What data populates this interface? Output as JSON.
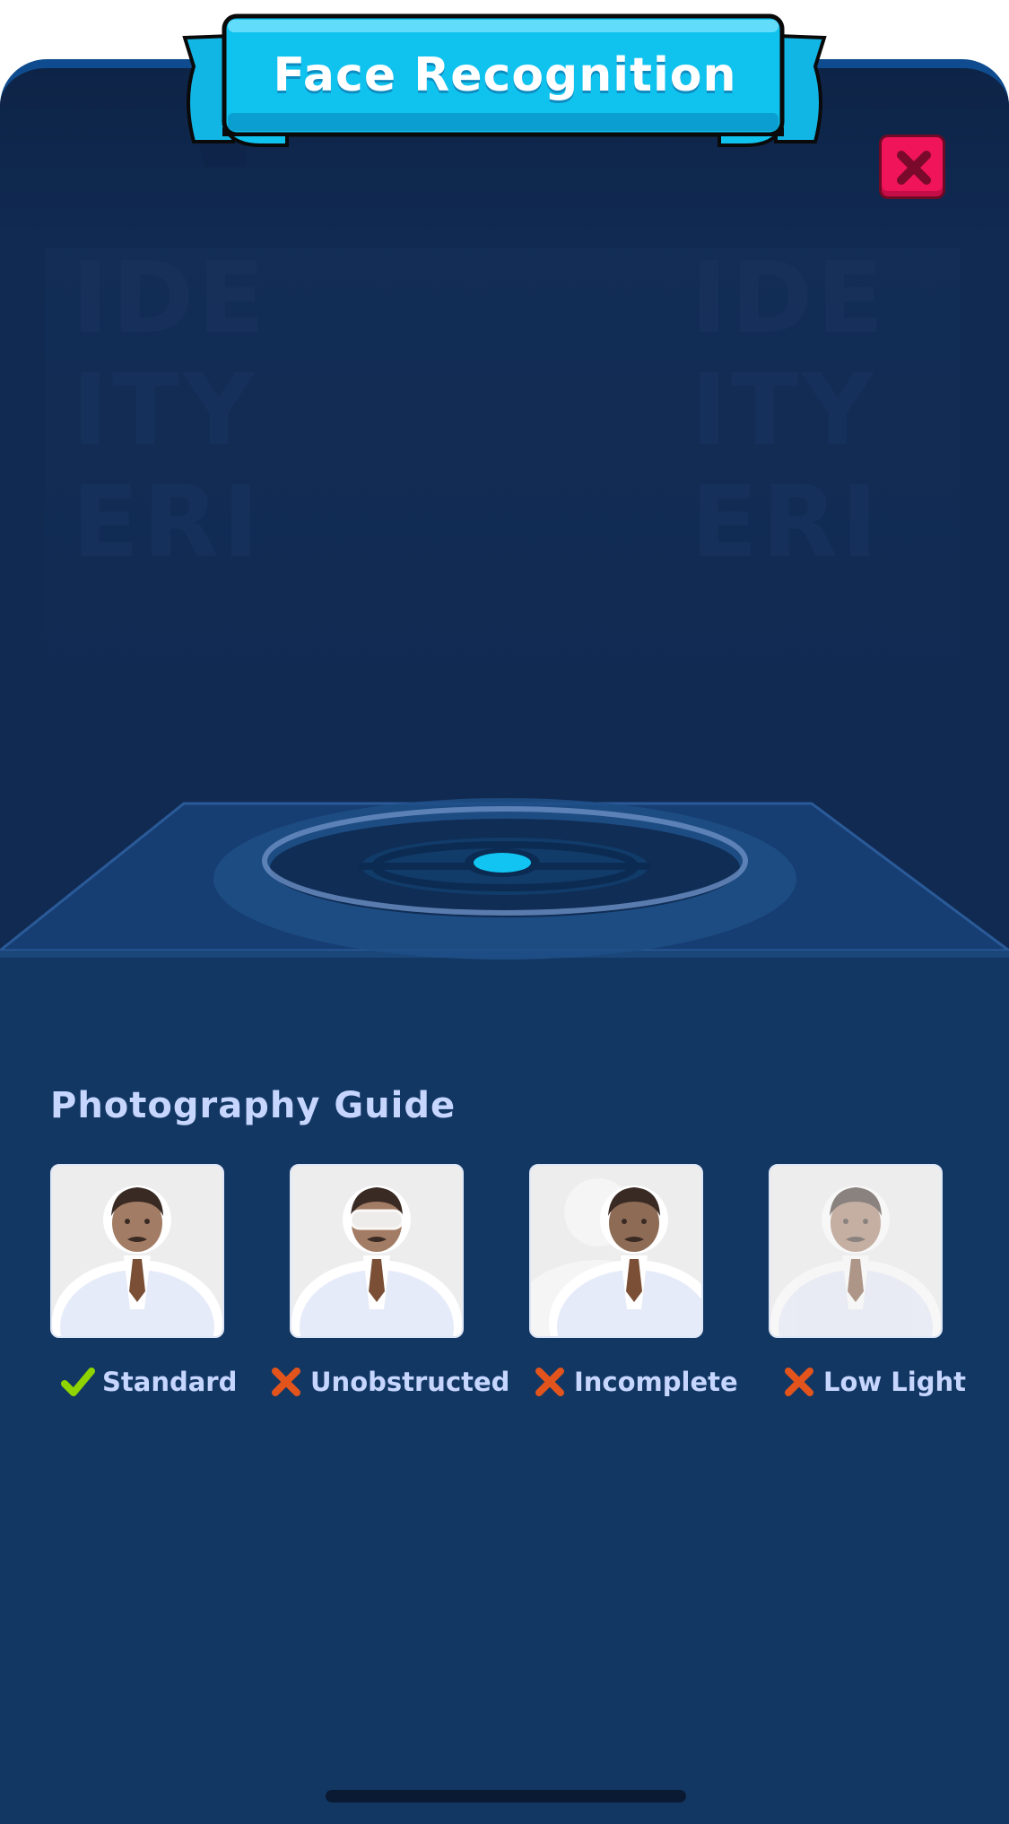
{
  "header": {
    "title": "Face Recognition",
    "close_icon": "close-icon"
  },
  "background": {
    "watermark_left": "IDE\nITY\nERI",
    "watermark_right": "IDE\nITY\nERI"
  },
  "guide": {
    "title": "Photography Guide",
    "items": [
      {
        "label": "Standard",
        "status": "ok",
        "status_icon": "check-icon"
      },
      {
        "label": "Unobstructed",
        "status": "bad",
        "status_icon": "cross-icon"
      },
      {
        "label": "Incomplete",
        "status": "bad",
        "status_icon": "cross-icon"
      },
      {
        "label": "Low Light",
        "status": "bad",
        "status_icon": "cross-icon"
      }
    ]
  },
  "colors": {
    "panel": "#102a52",
    "ribbon": "#10c3ef",
    "close": "#f0145a",
    "check": "#8fd400",
    "cross": "#e2541c",
    "guide_text": "#c7d6ff"
  }
}
